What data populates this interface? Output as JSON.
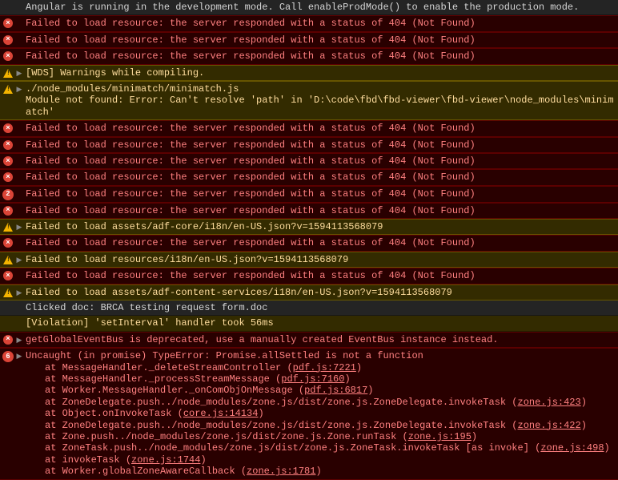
{
  "lines": [
    {
      "type": "log",
      "expandable": false,
      "text": "Angular is running in the development mode. Call enableProdMode() to enable the production mode."
    },
    {
      "type": "error",
      "expandable": false,
      "icon": "x",
      "text": "Failed to load resource: the server responded with a status of 404 (Not Found)"
    },
    {
      "type": "error",
      "expandable": false,
      "icon": "x",
      "text": "Failed to load resource: the server responded with a status of 404 (Not Found)"
    },
    {
      "type": "error",
      "expandable": false,
      "icon": "x",
      "text": "Failed to load resource: the server responded with a status of 404 (Not Found)"
    },
    {
      "type": "warn",
      "expandable": true,
      "icon": "warn",
      "text": "[WDS] Warnings while compiling."
    },
    {
      "type": "warn",
      "expandable": true,
      "icon": "warn",
      "text": "./node_modules/minimatch/minimatch.js\nModule not found: Error: Can't resolve 'path' in 'D:\\code\\fbd\\fbd-viewer\\fbd-viewer\\node_modules\\minimatch'"
    },
    {
      "type": "error",
      "expandable": false,
      "icon": "x",
      "text": "Failed to load resource: the server responded with a status of 404 (Not Found)"
    },
    {
      "type": "error",
      "expandable": false,
      "icon": "x",
      "text": "Failed to load resource: the server responded with a status of 404 (Not Found)"
    },
    {
      "type": "error",
      "expandable": false,
      "icon": "x",
      "text": "Failed to load resource: the server responded with a status of 404 (Not Found)"
    },
    {
      "type": "error",
      "expandable": false,
      "icon": "x",
      "text": "Failed to load resource: the server responded with a status of 404 (Not Found)"
    },
    {
      "type": "error",
      "expandable": false,
      "icon": "badge",
      "badge": "2",
      "text": "Failed to load resource: the server responded with a status of 404 (Not Found)"
    },
    {
      "type": "error",
      "expandable": false,
      "icon": "x",
      "text": "Failed to load resource: the server responded with a status of 404 (Not Found)"
    },
    {
      "type": "warn",
      "expandable": true,
      "icon": "warn",
      "text": "Failed to load assets/adf-core/i18n/en-US.json?v=1594113568079"
    },
    {
      "type": "error",
      "expandable": false,
      "icon": "x",
      "text": "Failed to load resource: the server responded with a status of 404 (Not Found)"
    },
    {
      "type": "warn",
      "expandable": true,
      "icon": "warn",
      "text": "Failed to load resources/i18n/en-US.json?v=1594113568079"
    },
    {
      "type": "error",
      "expandable": false,
      "icon": "x",
      "text": "Failed to load resource: the server responded with a status of 404 (Not Found)"
    },
    {
      "type": "warn",
      "expandable": true,
      "icon": "warn",
      "text": "Failed to load assets/adf-content-services/i18n/en-US.json?v=1594113568079"
    },
    {
      "type": "log",
      "expandable": false,
      "text": "Clicked doc: BRCA testing request form.doc"
    },
    {
      "type": "violation",
      "expandable": false,
      "text": "[Violation] 'setInterval' handler took 56ms"
    },
    {
      "type": "error",
      "expandable": true,
      "icon": "x",
      "text": "getGlobalEventBus is deprecated, use a manually created EventBus instance instead."
    }
  ],
  "uncaught": {
    "badge": "6",
    "header": "Uncaught (in promise) TypeError: Promise.allSettled is not a function",
    "frames": [
      {
        "text": "at MessageHandler._deleteStreamController (",
        "link": "pdf.js:7221",
        "suffix": ")"
      },
      {
        "text": "at MessageHandler._processStreamMessage (",
        "link": "pdf.js:7160",
        "suffix": ")"
      },
      {
        "text": "at Worker.MessageHandler._onComObjOnMessage (",
        "link": "pdf.js:6817",
        "suffix": ")"
      },
      {
        "text": "at ZoneDelegate.push../node_modules/zone.js/dist/zone.js.ZoneDelegate.invokeTask (",
        "link": "zone.js:423",
        "suffix": ")"
      },
      {
        "text": "at Object.onInvokeTask (",
        "link": "core.js:14134",
        "suffix": ")"
      },
      {
        "text": "at ZoneDelegate.push../node_modules/zone.js/dist/zone.js.ZoneDelegate.invokeTask (",
        "link": "zone.js:422",
        "suffix": ")"
      },
      {
        "text": "at Zone.push../node_modules/zone.js/dist/zone.js.Zone.runTask (",
        "link": "zone.js:195",
        "suffix": ")"
      },
      {
        "text": "at ZoneTask.push../node_modules/zone.js/dist/zone.js.ZoneTask.invokeTask [as invoke] (",
        "link": "zone.js:498",
        "suffix": ")"
      },
      {
        "text": "at invokeTask (",
        "link": "zone.js:1744",
        "suffix": ")"
      },
      {
        "text": "at Worker.globalZoneAwareCallback (",
        "link": "zone.js:1781",
        "suffix": ")"
      }
    ]
  }
}
